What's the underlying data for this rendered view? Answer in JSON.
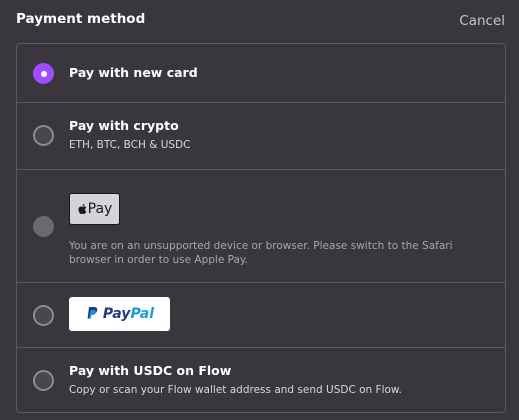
{
  "header": {
    "title": "Payment method",
    "cancel_label": "Cancel"
  },
  "options": [
    {
      "label": "Pay with new card",
      "selected": true
    },
    {
      "label": "Pay with crypto",
      "sub": "ETH, BTC, BCH & USDC",
      "selected": false
    },
    {
      "button_label": "Pay",
      "icon": "apple-logo-icon",
      "note": "You are on an unsupported device or browser. Please switch to the Safari browser in order to use Apple Pay.",
      "disabled": true
    },
    {
      "brand_part1": "Pay",
      "brand_part2": "Pal",
      "icon": "paypal-logo-icon",
      "selected": false
    },
    {
      "label": "Pay with USDC on Flow",
      "sub": "Copy or scan your Flow wallet address and send USDC on Flow.",
      "selected": false
    }
  ],
  "colors": {
    "background": "#3a363d",
    "accent": "#a14bff",
    "border": "#5c5860"
  }
}
